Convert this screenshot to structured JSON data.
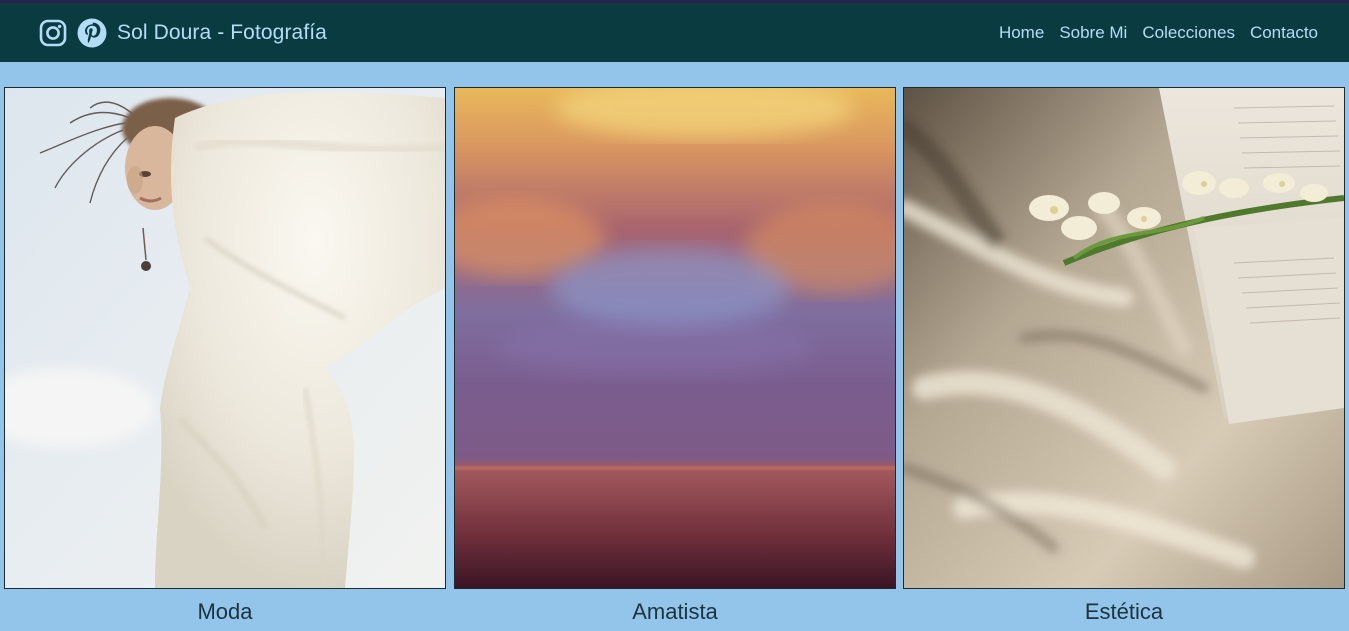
{
  "header": {
    "title": "Sol Doura - Fotografía",
    "social": [
      {
        "icon": "instagram-icon"
      },
      {
        "icon": "pinterest-icon"
      }
    ]
  },
  "nav": {
    "items": [
      "Home",
      "Sobre Mi",
      "Colecciones",
      "Contacto"
    ]
  },
  "gallery": {
    "items": [
      {
        "caption": "Moda"
      },
      {
        "caption": "Amatista"
      },
      {
        "caption": "Estética"
      }
    ]
  },
  "colors": {
    "header_bg": "#093b40",
    "page_bg": "#93c5ea",
    "nav_text": "#b4dcf6",
    "caption_text": "#1c3440"
  }
}
